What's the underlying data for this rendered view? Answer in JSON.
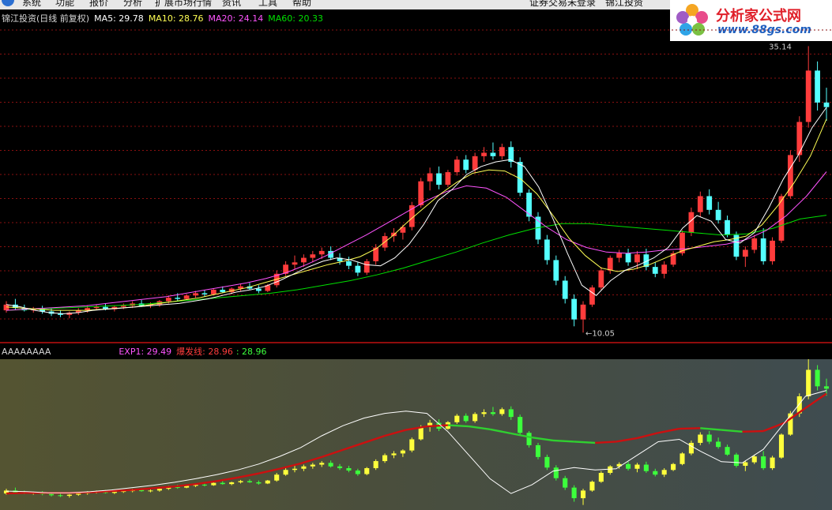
{
  "menu": {
    "items": [
      "系统",
      "功能",
      "报价",
      "分析",
      "扩展市场行情",
      "资讯",
      "工具",
      "帮助"
    ],
    "right_items": [
      "证券交易未登录",
      "锦江投资"
    ]
  },
  "brand": {
    "title": "分析家公式网",
    "url": "www.88gs.com"
  },
  "main_legend": {
    "title": "锦江投资(日线 前复权)",
    "ma5": "MA5: 29.78",
    "ma10": "MA10: 28.76",
    "ma20": "MA20: 24.14",
    "ma60": "MA60: 20.33"
  },
  "sub_legend": {
    "name": "AAAAAAAA",
    "exp1": "EXP1: 29.49",
    "burst": "爆发线: 28.96",
    "burst_val": ": 28.96"
  },
  "annotations": {
    "high": "35.14",
    "low": "←10.05"
  },
  "colors": {
    "up": "#ff3c3c",
    "down": "#54ffff",
    "ma5": "#ffffff",
    "ma10": "#ffff54",
    "ma20": "#ff54ff",
    "ma60": "#00e000",
    "grid": "#8a1010",
    "sub_up": "#ffff3c",
    "sub_down": "#3cff3c",
    "exp1": "#ffffff",
    "burst": "#cc1010"
  },
  "chart_data": {
    "type": "candlestick",
    "y_range": [
      10.0,
      36.0
    ],
    "candles": [
      [
        12.0,
        12.8,
        11.8,
        12.5
      ],
      [
        12.5,
        13.0,
        12.0,
        12.2
      ],
      [
        12.2,
        12.5,
        11.9,
        12.0
      ],
      [
        12.0,
        12.3,
        11.8,
        12.1
      ],
      [
        12.1,
        12.4,
        11.7,
        11.9
      ],
      [
        11.9,
        12.2,
        11.5,
        11.7
      ],
      [
        11.7,
        12.0,
        11.4,
        11.6
      ],
      [
        11.6,
        11.9,
        11.3,
        11.8
      ],
      [
        11.8,
        12.2,
        11.6,
        12.0
      ],
      [
        12.0,
        12.4,
        11.8,
        12.2
      ],
      [
        12.2,
        12.5,
        12.0,
        12.3
      ],
      [
        12.3,
        12.6,
        12.0,
        12.1
      ],
      [
        12.1,
        12.4,
        11.9,
        12.3
      ],
      [
        12.3,
        12.6,
        12.1,
        12.4
      ],
      [
        12.4,
        12.8,
        12.2,
        12.6
      ],
      [
        12.6,
        12.9,
        12.3,
        12.4
      ],
      [
        12.4,
        12.7,
        12.2,
        12.5
      ],
      [
        12.5,
        12.9,
        12.3,
        12.8
      ],
      [
        12.8,
        13.3,
        12.6,
        13.1
      ],
      [
        13.1,
        13.5,
        12.8,
        13.0
      ],
      [
        13.0,
        13.4,
        12.9,
        13.3
      ],
      [
        13.3,
        13.7,
        13.1,
        13.5
      ],
      [
        13.5,
        13.8,
        13.2,
        13.4
      ],
      [
        13.4,
        13.9,
        13.3,
        13.8
      ],
      [
        13.8,
        14.1,
        13.5,
        13.6
      ],
      [
        13.6,
        14.0,
        13.4,
        13.9
      ],
      [
        13.9,
        14.3,
        13.7,
        14.1
      ],
      [
        14.1,
        14.4,
        13.8,
        13.9
      ],
      [
        13.9,
        14.2,
        13.5,
        13.7
      ],
      [
        13.7,
        14.3,
        13.6,
        14.2
      ],
      [
        14.2,
        15.5,
        14.0,
        15.2
      ],
      [
        15.2,
        16.3,
        15.0,
        16.0
      ],
      [
        16.0,
        16.8,
        15.6,
        16.2
      ],
      [
        16.2,
        16.9,
        15.8,
        16.6
      ],
      [
        16.6,
        17.2,
        16.2,
        16.9
      ],
      [
        16.9,
        17.5,
        16.5,
        17.2
      ],
      [
        17.2,
        17.6,
        16.4,
        16.6
      ],
      [
        16.6,
        17.0,
        16.0,
        16.3
      ],
      [
        16.3,
        16.7,
        15.6,
        15.9
      ],
      [
        15.9,
        16.2,
        15.0,
        15.3
      ],
      [
        15.3,
        16.5,
        15.1,
        16.3
      ],
      [
        16.3,
        17.8,
        16.0,
        17.5
      ],
      [
        17.5,
        18.8,
        17.2,
        18.5
      ],
      [
        18.5,
        19.2,
        18.0,
        18.8
      ],
      [
        18.8,
        19.5,
        18.2,
        19.3
      ],
      [
        19.3,
        21.5,
        19.0,
        21.2
      ],
      [
        21.2,
        23.6,
        21.0,
        23.3
      ],
      [
        23.3,
        24.5,
        22.5,
        24.0
      ],
      [
        24.0,
        24.6,
        22.6,
        23.0
      ],
      [
        23.0,
        24.3,
        22.8,
        24.1
      ],
      [
        24.1,
        25.5,
        23.8,
        25.2
      ],
      [
        25.2,
        25.6,
        24.0,
        24.3
      ],
      [
        24.3,
        25.8,
        24.0,
        25.5
      ],
      [
        25.5,
        26.3,
        25.0,
        25.8
      ],
      [
        25.8,
        26.7,
        25.2,
        25.5
      ],
      [
        25.5,
        26.6,
        25.2,
        26.3
      ],
      [
        26.3,
        26.8,
        24.5,
        25.0
      ],
      [
        25.0,
        25.4,
        22.0,
        22.3
      ],
      [
        22.3,
        22.6,
        19.8,
        20.2
      ],
      [
        20.2,
        20.6,
        17.8,
        18.2
      ],
      [
        18.2,
        18.6,
        16.0,
        16.4
      ],
      [
        16.4,
        16.8,
        14.2,
        14.6
      ],
      [
        14.6,
        15.0,
        12.6,
        13.0
      ],
      [
        13.0,
        13.4,
        10.6,
        11.2
      ],
      [
        11.2,
        12.8,
        10.05,
        12.5
      ],
      [
        12.5,
        14.2,
        12.3,
        14.0
      ],
      [
        14.0,
        15.8,
        13.8,
        15.5
      ],
      [
        15.5,
        16.8,
        15.2,
        16.6
      ],
      [
        16.6,
        17.3,
        16.2,
        17.0
      ],
      [
        17.0,
        17.4,
        15.9,
        16.2
      ],
      [
        16.2,
        17.2,
        15.6,
        16.9
      ],
      [
        16.9,
        17.4,
        15.5,
        15.8
      ],
      [
        15.8,
        16.2,
        14.9,
        15.2
      ],
      [
        15.2,
        16.3,
        14.8,
        16.0
      ],
      [
        16.0,
        17.2,
        15.8,
        17.0
      ],
      [
        17.0,
        19.0,
        16.8,
        18.8
      ],
      [
        18.8,
        21.0,
        18.5,
        20.6
      ],
      [
        20.6,
        22.4,
        20.2,
        22.0
      ],
      [
        22.0,
        22.6,
        20.4,
        20.8
      ],
      [
        20.8,
        21.5,
        19.6,
        19.9
      ],
      [
        19.9,
        20.3,
        18.4,
        18.6
      ],
      [
        18.6,
        18.9,
        16.4,
        16.7
      ],
      [
        16.7,
        17.6,
        15.8,
        17.3
      ],
      [
        17.3,
        18.6,
        17.0,
        18.3
      ],
      [
        18.3,
        19.2,
        16.0,
        16.3
      ],
      [
        16.3,
        18.4,
        16.0,
        18.1
      ],
      [
        18.1,
        22.2,
        17.9,
        22.0
      ],
      [
        22.0,
        26.0,
        21.8,
        25.6
      ],
      [
        25.6,
        29.0,
        25.0,
        28.5
      ],
      [
        28.5,
        35.14,
        28.0,
        33.0
      ],
      [
        33.0,
        33.8,
        29.5,
        30.2
      ],
      [
        30.2,
        31.5,
        28.6,
        29.8
      ]
    ],
    "ma5": [
      12.5,
      12.3,
      12.0,
      11.8,
      11.7,
      11.8,
      12.0,
      12.1,
      12.2,
      12.3,
      12.4,
      12.5,
      12.6,
      12.8,
      13.0,
      13.3,
      13.6,
      13.8,
      14.1,
      14.6,
      15.2,
      15.8,
      16.3,
      16.6,
      16.4,
      16.0,
      15.9,
      16.6,
      17.8,
      19.5,
      21.6,
      22.6,
      23.9,
      24.6,
      25.0,
      25.2,
      24.6,
      22.8,
      20.0,
      17.0,
      14.2,
      13.3,
      14.6,
      15.5,
      16.0,
      16.6,
      17.5,
      19.2,
      20.3,
      19.8,
      18.2,
      17.9,
      18.8,
      21.0,
      23.5,
      25.5,
      28.0,
      29.78
    ],
    "ma10": [
      12.3,
      12.2,
      12.1,
      12.0,
      12.0,
      12.0,
      12.1,
      12.2,
      12.3,
      12.5,
      12.7,
      12.9,
      13.1,
      13.4,
      13.7,
      14.0,
      14.4,
      14.8,
      15.2,
      15.6,
      16.0,
      16.3,
      16.7,
      17.4,
      18.5,
      19.8,
      21.0,
      22.2,
      23.2,
      24.0,
      24.3,
      24.2,
      23.5,
      22.2,
      20.3,
      18.3,
      16.8,
      15.7,
      15.4,
      15.6,
      16.0,
      16.6,
      17.2,
      17.6,
      18.0,
      18.2,
      18.5,
      19.5,
      21.2,
      23.2,
      25.5,
      28.76
    ],
    "ma20": [
      12.0,
      12.1,
      12.2,
      12.3,
      12.4,
      12.6,
      12.8,
      13.0,
      13.2,
      13.5,
      13.8,
      14.1,
      14.4,
      14.8,
      15.3,
      16.0,
      16.8,
      17.7,
      18.6,
      19.6,
      20.6,
      21.6,
      22.4,
      22.9,
      22.7,
      21.9,
      20.6,
      19.3,
      18.2,
      17.5,
      17.1,
      17.0,
      17.1,
      17.3,
      17.4,
      17.6,
      17.8,
      18.2,
      19.0,
      20.3,
      22.0,
      24.14
    ],
    "ma60": [
      12.0,
      12.1,
      12.2,
      12.3,
      12.4,
      12.5,
      12.7,
      12.9,
      13.1,
      13.3,
      13.5,
      13.8,
      14.2,
      14.6,
      15.1,
      15.7,
      16.4,
      17.1,
      17.9,
      18.6,
      19.2,
      19.6,
      19.6,
      19.4,
      19.2,
      19.0,
      18.8,
      18.6,
      18.7,
      19.2,
      20.0,
      20.33
    ],
    "sub": {
      "exp1": [
        12.4,
        12.3,
        12.1,
        12.1,
        12.3,
        12.6,
        13.0,
        13.4,
        13.9,
        14.5,
        15.2,
        16.0,
        17.0,
        18.3,
        19.8,
        21.8,
        23.5,
        24.8,
        25.6,
        26.0,
        25.6,
        22.5,
        18.5,
        14.5,
        12.0,
        13.5,
        15.8,
        16.4,
        16.0,
        16.2,
        18.5,
        20.8,
        21.2,
        19.2,
        17.4,
        17.2,
        19.5,
        24.0,
        28.5,
        29.49
      ],
      "burst": [
        12.0,
        12.1,
        12.1,
        12.1,
        12.2,
        12.4,
        12.6,
        12.9,
        13.2,
        13.6,
        14.1,
        14.7,
        15.4,
        16.2,
        17.1,
        18.2,
        19.4,
        20.6,
        21.8,
        22.8,
        23.4,
        23.6,
        23.4,
        22.9,
        22.2,
        21.5,
        21.0,
        20.8,
        20.6,
        20.8,
        21.4,
        22.3,
        23.0,
        23.1,
        22.8,
        22.5,
        22.6,
        24.0,
        26.5,
        28.96
      ]
    }
  }
}
